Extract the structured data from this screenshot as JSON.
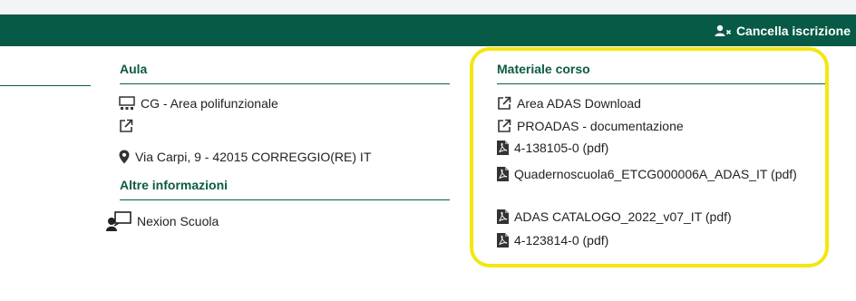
{
  "header": {
    "unsubscribe_label": "Cancella iscrizione",
    "background_color": "#075a45",
    "unsubscribe_icon": "user-x-icon"
  },
  "aula": {
    "title": "Aula",
    "room_name": "CG - Area polifunzionale",
    "room_icon": "classroom-icon",
    "external_link_icon": "external-link-icon",
    "address": "Via Carpi, 9 - 42015 CORREGGIO(RE) IT",
    "address_icon": "map-pin-icon"
  },
  "altre_informazioni": {
    "title": "Altre informazioni",
    "teacher": "Nexion Scuola",
    "teacher_icon": "teacher-icon"
  },
  "materiale_corso": {
    "title": "Materiale corso",
    "items": [
      {
        "label": "Area ADAS Download",
        "icon": "external-link-icon"
      },
      {
        "label": "PROADAS - documentazione",
        "icon": "external-link-icon"
      },
      {
        "label": "4-138105-0 (pdf)",
        "icon": "pdf-icon"
      },
      {
        "label": "Quadernoscuola6_ETCG000006A_ADAS_IT (pdf)",
        "icon": "pdf-icon"
      },
      {
        "label": "ADAS CATALOGO_2022_v07_IT (pdf)",
        "icon": "pdf-icon"
      },
      {
        "label": "4-123814-0 (pdf)",
        "icon": "pdf-icon"
      }
    ]
  },
  "colors": {
    "accent_green": "#0b5a45",
    "highlight_yellow": "#f4e60f"
  }
}
